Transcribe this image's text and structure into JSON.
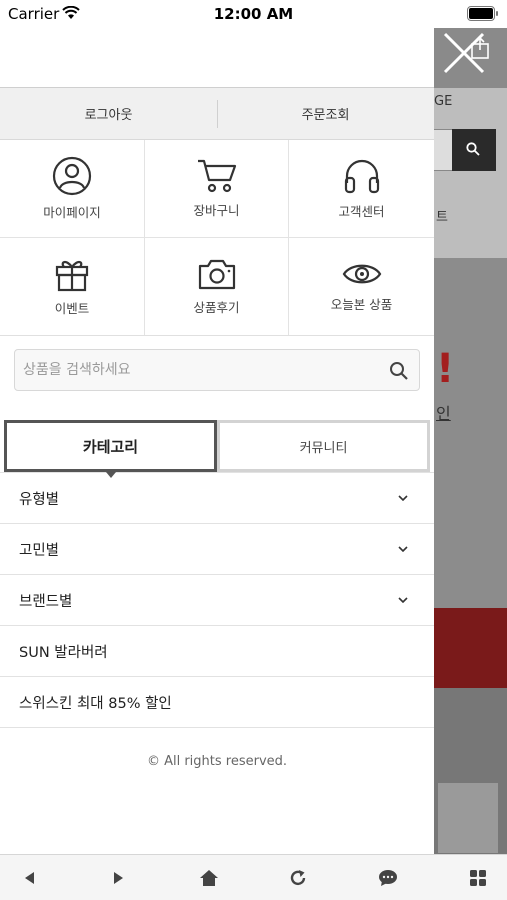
{
  "status_bar": {
    "carrier": "Carrier",
    "time": "12:00 AM"
  },
  "background_page": {
    "partial_text_top": "GE",
    "partial_text_mid": "트",
    "partial_text_excl": "!",
    "partial_text_link": "인"
  },
  "account_bar": {
    "logout_label": "로그아웃",
    "order_lookup_label": "주문조회"
  },
  "quick_menu": [
    {
      "label": "마이페이지",
      "icon": "person-icon"
    },
    {
      "label": "장바구니",
      "icon": "cart-icon"
    },
    {
      "label": "고객센터",
      "icon": "headphones-icon"
    },
    {
      "label": "이벤트",
      "icon": "gift-icon"
    },
    {
      "label": "상품후기",
      "icon": "camera-icon"
    },
    {
      "label": "오늘본 상품",
      "icon": "eye-icon"
    }
  ],
  "search": {
    "placeholder": "상품을 검색하세요",
    "value": ""
  },
  "tabs": [
    {
      "label": "카테고리",
      "active": true
    },
    {
      "label": "커뮤니티",
      "active": false
    }
  ],
  "categories": [
    {
      "label": "유형별",
      "expandable": true
    },
    {
      "label": "고민별",
      "expandable": true
    },
    {
      "label": "브랜드별",
      "expandable": true
    },
    {
      "label": "SUN 발라버려",
      "expandable": false
    },
    {
      "label": "스위스킨 최대 85% 할인",
      "expandable": false
    }
  ],
  "footer": {
    "copyright": "© All rights reserved."
  },
  "bottom_toolbar": [
    "back-icon",
    "forward-icon",
    "home-icon",
    "refresh-icon",
    "chat-icon",
    "grid-icon"
  ],
  "colors": {
    "accent_dark": "#555555",
    "bg_overlay": "#6d6d6d",
    "brand_red": "#a31e1e"
  }
}
